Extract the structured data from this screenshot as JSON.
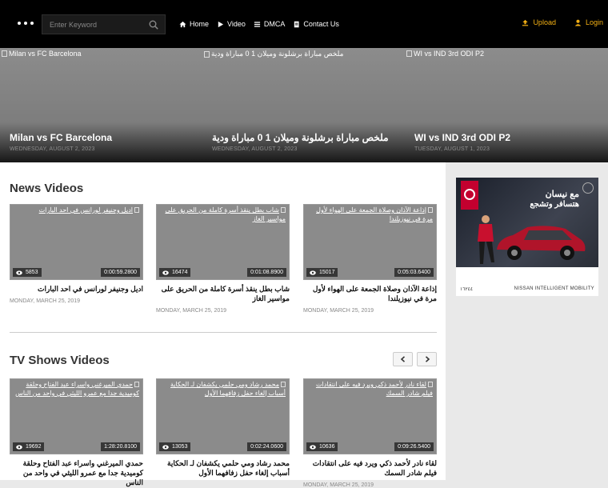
{
  "header": {
    "search_placeholder": "Enter Keyword",
    "nav": [
      {
        "label": "Home",
        "icon": "home-icon"
      },
      {
        "label": "Video",
        "icon": "play-icon"
      },
      {
        "label": "DMCA",
        "icon": "menu-icon"
      },
      {
        "label": "Contact Us",
        "icon": "document-icon"
      }
    ],
    "upload_label": "Upload",
    "login_label": "Login",
    "accent_color": "#f3b014"
  },
  "hero": [
    {
      "alt": "Milan vs FC Barcelona",
      "title": "Milan vs FC Barcelona",
      "date": "WEDNESDAY, AUGUST 2, 2023"
    },
    {
      "alt": "ملخص مباراة برشلونة وميلان 1 0 مباراة ودية",
      "title": "ملخص مباراة برشلونة وميلان 1 0 مباراة ودية",
      "date": "WEDNESDAY, AUGUST 2, 2023"
    },
    {
      "alt": "WI vs IND 3rd ODI P2",
      "title": "WI vs IND 3rd ODI P2",
      "date": "TUESDAY, AUGUST 1, 2023"
    }
  ],
  "news": {
    "title": "News Videos",
    "items": [
      {
        "alt": "اديل وجنيفر لورانس في احد البارات",
        "views": "5853",
        "duration": "0:00:59.2800",
        "title": "اديل وجنيفر لورانس في احد البارات",
        "date": "MONDAY, MARCH 25, 2019"
      },
      {
        "alt": "شاب بطل ينقذ أسرة كاملة من الحريق على مواسير الغاز",
        "views": "16474",
        "duration": "0:01:08.8900",
        "title": "شاب بطل ينقذ أسرة كاملة من الحريق على مواسير الغاز",
        "date": "MONDAY, MARCH 25, 2019"
      },
      {
        "alt": "إذاعة الآذان وصلاة الجمعة على الهواء لأول مرة في نيوزيلندا",
        "views": "15017",
        "duration": "0:05:03.6400",
        "title": "إذاعة الآذان وصلاة الجمعة على الهواء لأول مرة في نيوزيلندا",
        "date": "MONDAY, MARCH 25, 2019"
      }
    ]
  },
  "tvshows": {
    "title": "TV Shows Videos",
    "items": [
      {
        "alt": "حمدي الميرغني واسراء عبد الفتاح وحلقة كوميدية جدا مع عمرو الليثي في واحد من الناس",
        "views": "19692",
        "duration": "1:28:20.8100",
        "title": "حمدي الميرغني واسراء عبد الفتاح وحلقة كوميدية جدا مع عمرو الليثي في واحد من الناس",
        "date": ""
      },
      {
        "alt": "محمد رشاد ومي حلمي يكشفان لـ الحكاية أسباب إلغاء حفل زفافهما الأول",
        "views": "13053",
        "duration": "0:02:24.0600",
        "title": "محمد رشاد ومي حلمي يكشفان لـ الحكاية أسباب إلغاء حفل زفافهما الأول",
        "date": ""
      },
      {
        "alt": "لقاء نادر لأحمد ذكي ويرد فيه على انتقادات فيلم شادر السمك",
        "views": "10636",
        "duration": "0:09:26.5400",
        "title": "لقاء نادر لأحمد ذكي ويرد فيه على انتقادات فيلم شادر السمك",
        "date": "MONDAY, MARCH 25, 2019"
      }
    ]
  },
  "ad": {
    "headline": "مع نيسان",
    "subline": "هتسافر وتشجع",
    "footer_left": "١٦٢٤٤",
    "footer_right": "NISSAN INTELLIGENT MOBILITY",
    "brand_color": "#c3002f"
  }
}
